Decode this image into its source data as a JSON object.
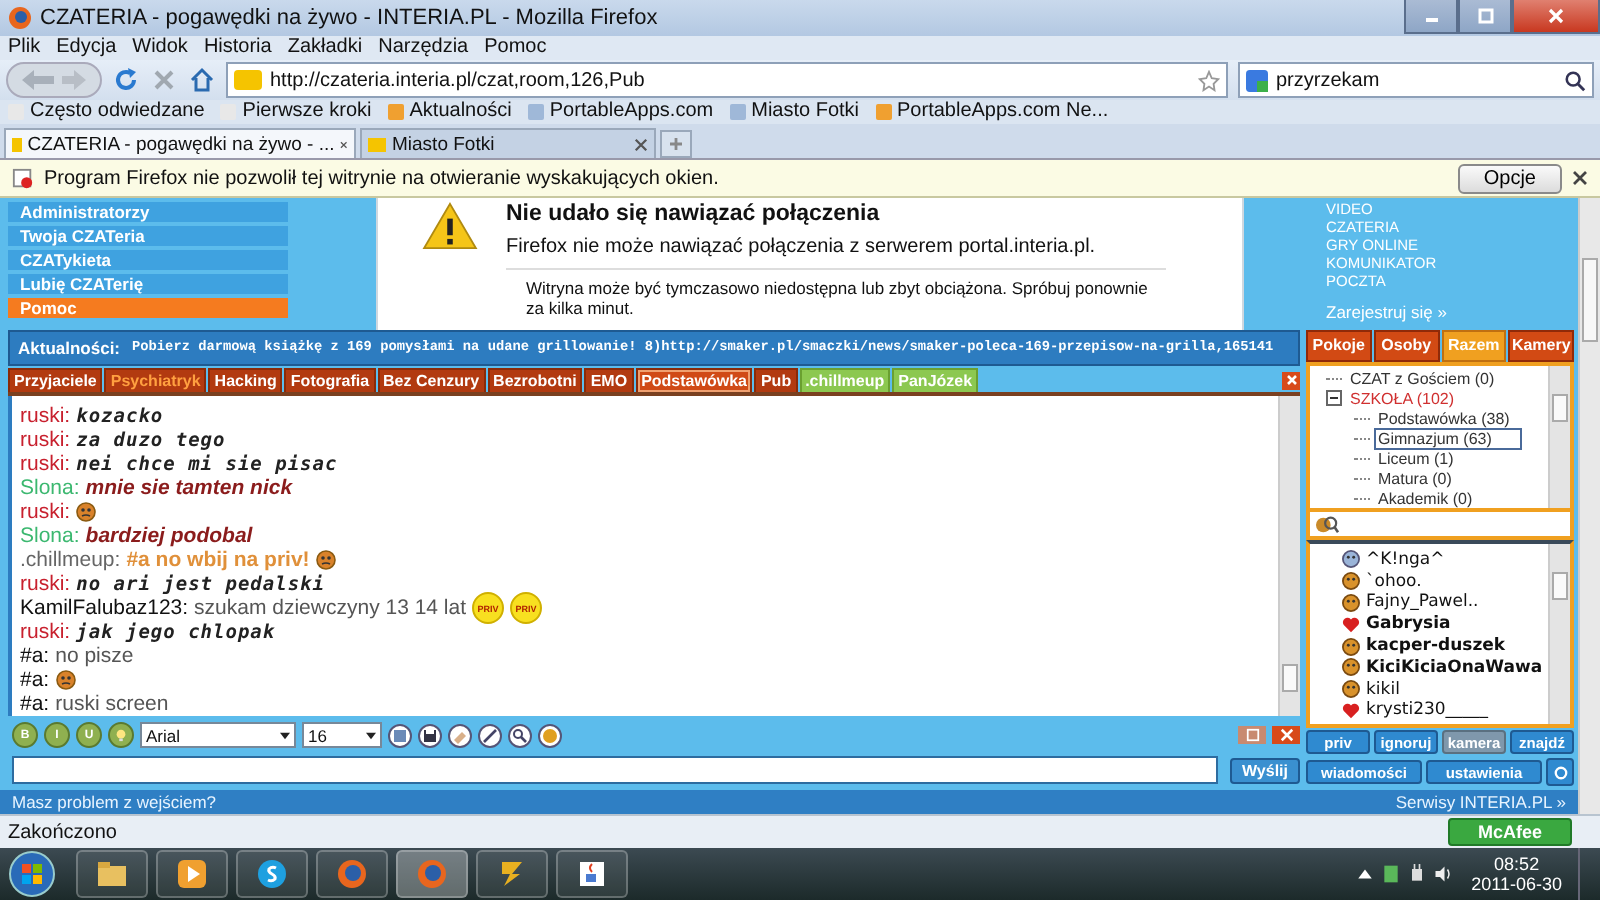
{
  "window": {
    "title": "CZATERIA - pogawędki na żywo - INTERIA.PL - Mozilla Firefox"
  },
  "menu": [
    "Plik",
    "Edycja",
    "Widok",
    "Historia",
    "Zakładki",
    "Narzędzia",
    "Pomoc"
  ],
  "address": {
    "value": "http://czateria.interia.pl/czat,room,126,Pub"
  },
  "search": {
    "value": "przyrzekam"
  },
  "bookmarks": [
    {
      "label": "Często odwiedzane",
      "kind": "page"
    },
    {
      "label": "Pierwsze kroki",
      "kind": "page"
    },
    {
      "label": "Aktualności",
      "kind": "feed"
    },
    {
      "label": "PortableApps.com",
      "kind": "site"
    },
    {
      "label": "Miasto Fotki",
      "kind": "site"
    },
    {
      "label": "PortableApps.com Ne...",
      "kind": "feed"
    }
  ],
  "tabs": [
    {
      "label": "CZATERIA - pogawędki na żywo - ...",
      "selected": true
    },
    {
      "label": "Miasto Fotki",
      "selected": false
    }
  ],
  "popup_notice": {
    "text": "Program Firefox nie pozwolił tej witrynie na otwieranie wyskakujących okien.",
    "button": "Opcje"
  },
  "site_nav": [
    {
      "label": "Administratorzy",
      "selected": false
    },
    {
      "label": "Twoja CZATeria",
      "selected": false
    },
    {
      "label": "CZATykieta",
      "selected": false
    },
    {
      "label": "Lubię CZATerię",
      "selected": false
    },
    {
      "label": "Pomoc",
      "selected": true
    }
  ],
  "error": {
    "title": "Nie udało się nawiązać połączenia",
    "message": "Firefox nie może nawiązać połączenia z serwerem portal.interia.pl.",
    "bullets": [
      "Witryna może być tymczasowo niedostępna lub zbyt obciążona. Spróbuj ponownie za kilka minut."
    ]
  },
  "site_links": [
    "VIDEO",
    "CZATERIA",
    "GRY ONLINE",
    "KOMUNIKATOR",
    "POCZTA"
  ],
  "register_link": "Zarejestruj się »",
  "news": {
    "label": "Aktualności:",
    "text": "Pobierz darmową książkę z 169 pomysłami na udane grillowanie! 8)http://smaker.pl/smaczki/news/smaker-poleca-169-przepisow-na-grilla,165141"
  },
  "panel_tabs": [
    {
      "label": "Pokoje",
      "selected": false
    },
    {
      "label": "Osoby",
      "selected": false
    },
    {
      "label": "Razem",
      "selected": true
    },
    {
      "label": "Kamery",
      "selected": false
    }
  ],
  "rooms": [
    {
      "label": "Przyjaciele",
      "kind": "room",
      "selected": false,
      "unread": false
    },
    {
      "label": "Psychiatryk",
      "kind": "room",
      "selected": false,
      "unread": true
    },
    {
      "label": "Hacking",
      "kind": "room",
      "selected": false,
      "unread": false
    },
    {
      "label": "Fotografia",
      "kind": "room",
      "selected": false,
      "unread": false
    },
    {
      "label": "Bez Cenzury",
      "kind": "room",
      "selected": false,
      "unread": false
    },
    {
      "label": "Bezrobotni",
      "kind": "room",
      "selected": false,
      "unread": false
    },
    {
      "label": "EMO",
      "kind": "room",
      "selected": false,
      "unread": false
    },
    {
      "label": "Podstawówka",
      "kind": "room",
      "selected": true,
      "unread": false
    },
    {
      "label": "Pub",
      "kind": "room",
      "selected": false,
      "unread": false
    },
    {
      "label": ".chillmeup",
      "kind": "private",
      "selected": false,
      "unread": false
    },
    {
      "label": "PanJózek",
      "kind": "private",
      "selected": false,
      "unread": false
    }
  ],
  "messages": [
    {
      "nick": "ruski:",
      "color": "#c8202e",
      "text": "kozacko",
      "kind": "mono",
      "emoticon": false
    },
    {
      "nick": "ruski:",
      "color": "#c8202e",
      "text": "za duzo tego",
      "kind": "mono",
      "emoticon": false
    },
    {
      "nick": "ruski:",
      "color": "#c8202e",
      "text": "nei chce mi sie pisac",
      "kind": "mono",
      "emoticon": false
    },
    {
      "nick": "Slona:",
      "color": "#3cb870",
      "text": "mnie sie tamten nick",
      "kind": "italic",
      "emoticon": false
    },
    {
      "nick": "ruski:",
      "color": "#c8202e",
      "emoticon": true
    },
    {
      "nick": "Slona:",
      "color": "#3cb870",
      "text": "bardziej podobal",
      "kind": "italic",
      "emoticon": false
    },
    {
      "nick": ".chillmeup:",
      "color": "#666666",
      "text": "#a  no wbij na priv!",
      "kind": "orange",
      "emoticon": true
    },
    {
      "nick": "ruski:",
      "color": "#c8202e",
      "text": "no ari jest pedalski",
      "kind": "mono",
      "emoticon": false
    },
    {
      "nick": "KamilFalubaz123:",
      "color": "#111111",
      "text": "szukam dziewczyny 13 14 lat",
      "kind": "plain",
      "emoticon": false,
      "badges": [
        "PRIV",
        "PRIV"
      ]
    },
    {
      "nick": "ruski:",
      "color": "#c8202e",
      "text": "jak jego chlopak",
      "kind": "mono",
      "emoticon": false
    },
    {
      "nick": "#a:",
      "color": "#111111",
      "text": "no pisze",
      "kind": "plain",
      "emoticon": false
    },
    {
      "nick": "#a:",
      "color": "#111111",
      "emoticon": true
    },
    {
      "nick": "#a:",
      "color": "#111111",
      "text": "ruski screen",
      "kind": "plain",
      "emoticon": false
    }
  ],
  "format": {
    "font": "Arial",
    "size": "16",
    "buttons": [
      "B",
      "I",
      "U"
    ]
  },
  "send_button": "Wyślij",
  "room_tree": [
    {
      "label": "CZAT z Gościem (0)",
      "selected": false
    },
    {
      "label": "SZKOŁA (102)",
      "selected": false,
      "expanded": true,
      "children": [
        {
          "label": "Podstawówka (38)",
          "selected": false
        },
        {
          "label": "Gimnazjum (63)",
          "selected": true
        },
        {
          "label": "Liceum (1)",
          "selected": false
        },
        {
          "label": "Matura (0)",
          "selected": false
        },
        {
          "label": "Akademik (0)",
          "selected": false
        }
      ]
    }
  ],
  "users": [
    {
      "name": "^K!nga^",
      "kind": "guest",
      "bold": false
    },
    {
      "name": "`ohoo.",
      "kind": "face",
      "bold": false
    },
    {
      "name": "Fajny_Pawel..",
      "kind": "face",
      "bold": false
    },
    {
      "name": "Gabrysia",
      "kind": "heart",
      "bold": true
    },
    {
      "name": "kacper-duszek",
      "kind": "face",
      "bold": true
    },
    {
      "name": "KiciKiciaOnaWawa",
      "kind": "face",
      "bold": true
    },
    {
      "name": "kikil",
      "kind": "face",
      "bold": false
    },
    {
      "name": "krysti230_____",
      "kind": "heart",
      "bold": false
    }
  ],
  "user_buttons": [
    {
      "label": "priv",
      "disabled": false
    },
    {
      "label": "ignoruj",
      "disabled": false
    },
    {
      "label": "kamera",
      "disabled": true
    },
    {
      "label": "znajdź",
      "disabled": false
    }
  ],
  "panel_buttons": [
    "wiadomości",
    "ustawienia"
  ],
  "footer": {
    "left": "Masz problem z wejściem?",
    "right": "Serwisy INTERIA.PL »"
  },
  "status_bar": {
    "text": "Zakończono",
    "badge": "McAfee"
  },
  "clock": {
    "time": "08:52",
    "date": "2011-06-30"
  }
}
